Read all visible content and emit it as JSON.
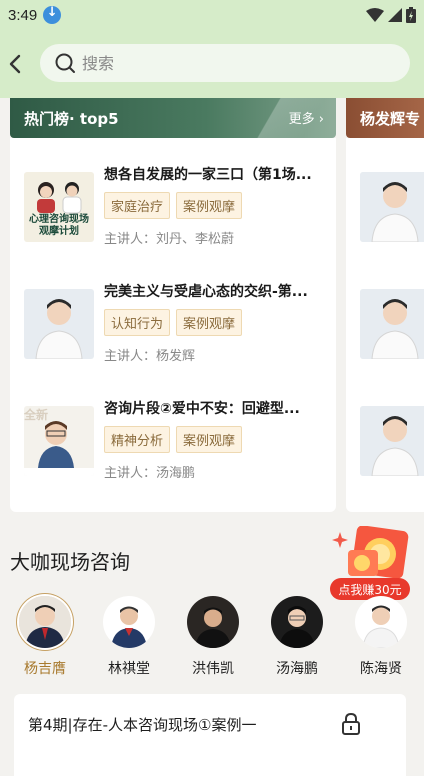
{
  "status_bar": {
    "time": "3:49"
  },
  "search": {
    "placeholder": "搜索"
  },
  "rank": {
    "title": "热门榜· top5",
    "more": "更多 ›",
    "items": [
      {
        "title": "想各自发展的一家三口（第1场...",
        "tags": [
          "家庭治疗",
          "案例观摩"
        ],
        "speaker": "主讲人：刘丹、李松蔚",
        "thumb_text": "心理咨询现场观摩计划"
      },
      {
        "title": "完美主义与受虐心态的交织-第...",
        "tags": [
          "认知行为",
          "案例观摩"
        ],
        "speaker": "主讲人：杨发辉"
      },
      {
        "title": "咨询片段②爱中不安：回避型...",
        "tags": [
          "精神分析",
          "案例观摩"
        ],
        "speaker": "主讲人：汤海鹏",
        "thumb_text": "全新"
      }
    ]
  },
  "second_card": {
    "title": "杨发辉专"
  },
  "section": {
    "title": "大咖现场咨询"
  },
  "promo": {
    "label": "点我赚30元"
  },
  "experts": [
    {
      "name": "杨吉膺",
      "active": true
    },
    {
      "name": "林祺堂",
      "active": false
    },
    {
      "name": "洪伟凯",
      "active": false
    },
    {
      "name": "汤海鹏",
      "active": false
    },
    {
      "name": "陈海贤",
      "active": false
    }
  ],
  "session": {
    "title": "第4期|存在-人本咨询现场①案例一"
  },
  "colors": {
    "header_bg": "#d6ecc9",
    "tag_bg": "#fdf3e2",
    "tag_text": "#8a6b3c",
    "active_name": "#a87a2e"
  }
}
